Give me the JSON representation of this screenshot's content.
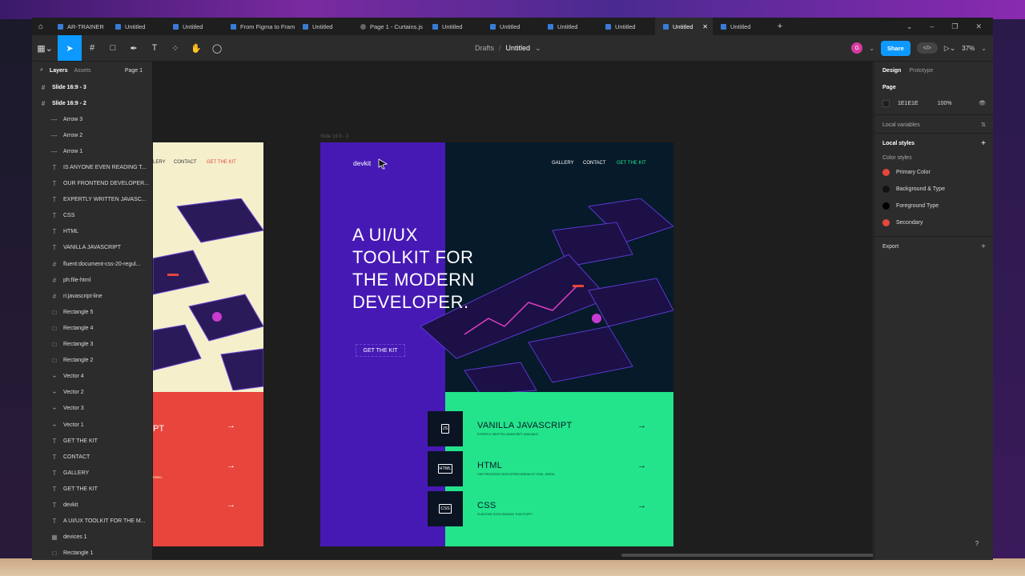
{
  "tabs": [
    {
      "label": "AR-TRAINER",
      "active": false
    },
    {
      "label": "Untitled",
      "active": false
    },
    {
      "label": "Untitled",
      "active": false
    },
    {
      "label": "From Figma to Framer",
      "active": false
    },
    {
      "label": "Untitled",
      "active": false
    },
    {
      "label": "Page 1 - Curtains.js st",
      "active": false
    },
    {
      "label": "Untitled",
      "active": false
    },
    {
      "label": "Untitled",
      "active": false
    },
    {
      "label": "Untitled",
      "active": false
    },
    {
      "label": "Untitled",
      "active": false
    },
    {
      "label": "Untitled",
      "active": true
    },
    {
      "label": "Untitled",
      "active": false
    }
  ],
  "toolbar": {
    "breadcrumb_root": "Drafts",
    "breadcrumb_sep": "/",
    "file_name": "Untitled",
    "avatar_initial": "G",
    "share_label": "Share",
    "zoom": "37%"
  },
  "left_panel": {
    "tab_layers": "Layers",
    "tab_assets": "Assets",
    "page_selector": "Page 1",
    "frames": [
      "Slide 16:9 - 3",
      "Slide 16:9 - 2"
    ],
    "layers": [
      {
        "icon": "—",
        "label": "Arrow 3"
      },
      {
        "icon": "—",
        "label": "Arrow 2"
      },
      {
        "icon": "—",
        "label": "Arrow 1"
      },
      {
        "icon": "T",
        "label": "IS ANYONE EVEN READING T..."
      },
      {
        "icon": "T",
        "label": "OUR FRONTEND DEVELOPER..."
      },
      {
        "icon": "T",
        "label": "EXPERTLY WRITTEN JAVASC..."
      },
      {
        "icon": "T",
        "label": "CSS"
      },
      {
        "icon": "T",
        "label": "HTML"
      },
      {
        "icon": "T",
        "label": "VANILLA JAVASCRIPT"
      },
      {
        "icon": "#",
        "label": "fluent:document-css-20-regul..."
      },
      {
        "icon": "#",
        "label": "ph:file-html"
      },
      {
        "icon": "#",
        "label": "ri:javascript-line"
      },
      {
        "icon": "□",
        "label": "Rectangle 5"
      },
      {
        "icon": "□",
        "label": "Rectangle 4"
      },
      {
        "icon": "□",
        "label": "Rectangle 3"
      },
      {
        "icon": "□",
        "label": "Rectangle 2"
      },
      {
        "icon": "⌁",
        "label": "Vector 4"
      },
      {
        "icon": "⌁",
        "label": "Vector 2"
      },
      {
        "icon": "⌁",
        "label": "Vector 3"
      },
      {
        "icon": "⌁",
        "label": "Vector 1"
      },
      {
        "icon": "T",
        "label": "GET THE KIT"
      },
      {
        "icon": "T",
        "label": "CONTACT"
      },
      {
        "icon": "T",
        "label": "GALLERY"
      },
      {
        "icon": "T",
        "label": "GET THE KIT"
      },
      {
        "icon": "T",
        "label": "devkit"
      },
      {
        "icon": "T",
        "label": "A UI/UX TOOLKIT FOR THE M..."
      },
      {
        "icon": "▦",
        "label": "devices 1"
      },
      {
        "icon": "□",
        "label": "Rectangle 1"
      }
    ]
  },
  "canvas": {
    "frame_label": "Slide 16:9 - 3",
    "frame1": {
      "nav_gallery": "LERY",
      "nav_contact": "CONTACT",
      "nav_kit": "GET THE KIT",
      "partial_title": "PT",
      "partial_sub": "ERED.",
      "arrow": "→"
    },
    "frame2": {
      "logo": "devkit",
      "nav_gallery": "GALLERY",
      "nav_contact": "CONTACT",
      "nav_kit": "GET THE KIT",
      "headline": [
        "A UI/UX",
        "TOOLKIT FOR",
        "THE MODERN",
        "DEVELOPER."
      ],
      "cta": "GET THE KIT",
      "features": [
        {
          "badge": "JS",
          "title": "VANILLA JAVASCRIPT",
          "sub": "EXPERTLY WRITTEN JAVASCRIPT AVAILABLE.",
          "arrow": "→"
        },
        {
          "badge": "HTML",
          "title": "HTML",
          "sub": "OUR FRONTEND DEVELOPERS DREAM OF HTML. WEIRD.",
          "arrow": "→"
        },
        {
          "badge": "CSS",
          "title": "CSS",
          "sub": "IS ANYONE EVEN READING THIS STUFF?",
          "arrow": "→"
        }
      ]
    }
  },
  "right_panel": {
    "tab_design": "Design",
    "tab_prototype": "Prototype",
    "page_title": "Page",
    "page_color": "1E1E1E",
    "page_opacity": "100%",
    "local_variables": "Local variables",
    "local_styles": "Local styles",
    "color_styles_label": "Color styles",
    "color_styles": [
      {
        "name": "Primary Color",
        "color": "#e8453c"
      },
      {
        "name": "Background & Type",
        "color": "#111111"
      },
      {
        "name": "Foreground Type",
        "color": "#000000"
      },
      {
        "name": "Secondary",
        "color": "#e8453c"
      }
    ],
    "export": "Export"
  },
  "help": "?"
}
